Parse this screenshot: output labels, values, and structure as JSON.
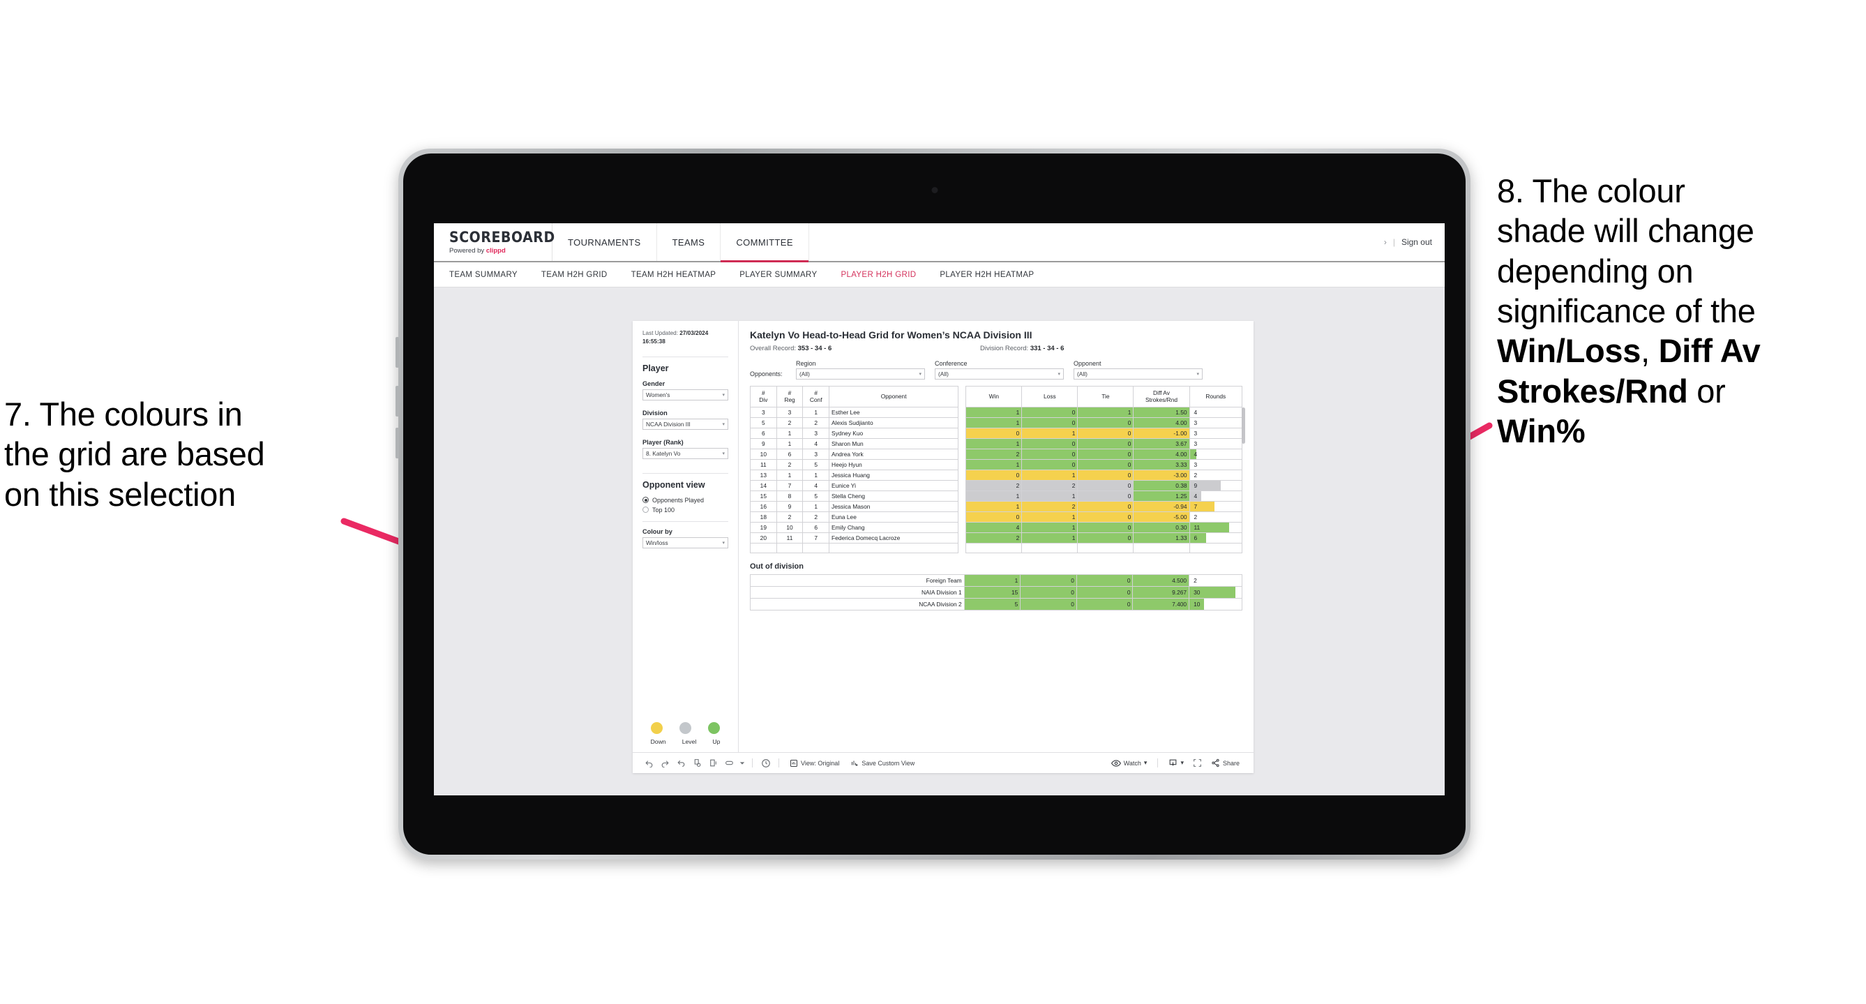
{
  "annotations": {
    "left": {
      "line1": "7. The colours in",
      "line2": "the grid are based",
      "line3": "on this selection"
    },
    "right": {
      "l1": "8. The colour",
      "l2": "shade will change",
      "l3": "depending on",
      "l4": "significance of the",
      "l5_bold_a": "Win/Loss",
      "l5_comma": ", ",
      "l5_bold_b": "Diff Av",
      "l6_bold": "Strokes/Rnd",
      "l6_or": " or",
      "l7_bold": "Win%"
    },
    "arrow_color": "#ea2a63"
  },
  "header": {
    "brand_name": "SCOREBOARD",
    "brand_sub_prefix": "Powered by ",
    "brand_sub_link": "clippd",
    "nav": [
      {
        "label": "TOURNAMENTS",
        "active": false
      },
      {
        "label": "TEAMS",
        "active": false
      },
      {
        "label": "COMMITTEE",
        "active": true
      }
    ],
    "chevron": "›",
    "separator": "|",
    "sign_out": "Sign out"
  },
  "subnav": [
    {
      "label": "TEAM SUMMARY",
      "active": false
    },
    {
      "label": "TEAM H2H GRID",
      "active": false
    },
    {
      "label": "TEAM H2H HEATMAP",
      "active": false
    },
    {
      "label": "PLAYER SUMMARY",
      "active": false
    },
    {
      "label": "PLAYER H2H GRID",
      "active": true
    },
    {
      "label": "PLAYER H2H HEATMAP",
      "active": false
    }
  ],
  "sidebar": {
    "last_updated_label": "Last Updated: ",
    "last_updated_value": "27/03/2024 16:55:38",
    "section_player": "Player",
    "gender_label": "Gender",
    "gender_value": "Women's",
    "division_label": "Division",
    "division_value": "NCAA Division III",
    "player_rank_label": "Player (Rank)",
    "player_rank_value": "8. Katelyn Vo",
    "opponent_view_label": "Opponent view",
    "opponent_view_options": [
      {
        "label": "Opponents Played",
        "selected": true
      },
      {
        "label": "Top 100",
        "selected": false
      }
    ],
    "colour_by_label": "Colour by",
    "colour_by_value": "Win/loss",
    "legend": [
      {
        "label": "Down",
        "color": "#f2d04b"
      },
      {
        "label": "Level",
        "color": "#c3c7cb"
      },
      {
        "label": "Up",
        "color": "#7dc462"
      }
    ]
  },
  "main": {
    "title": "Katelyn Vo Head-to-Head Grid for Women’s NCAA Division III",
    "overall_record_label": "Overall Record: ",
    "overall_record_value": "353 -  34 - 6",
    "division_record_label": "Division Record: ",
    "division_record_value": "331 -  34 - 6",
    "opponents_label": "Opponents:",
    "filters": [
      {
        "label": "Region",
        "value": "(All)"
      },
      {
        "label": "Conference",
        "value": "(All)"
      },
      {
        "label": "Opponent",
        "value": "(All)"
      }
    ]
  },
  "chart_data": {
    "type": "table",
    "title": "Katelyn Vo Head-to-Head Grid for Women’s NCAA Division III",
    "columns": [
      "# Div",
      "# Reg",
      "# Conf",
      "Opponent",
      "Win",
      "Loss",
      "Tie",
      "Diff Av Strokes/Rnd",
      "Rounds"
    ],
    "header_lines": {
      "div": [
        "#",
        "Div"
      ],
      "reg": [
        "#",
        "Reg"
      ],
      "conf": [
        "#",
        "Conf"
      ],
      "opponent": [
        "Opponent"
      ],
      "win": [
        "Win"
      ],
      "loss": [
        "Loss"
      ],
      "tie": [
        "Tie"
      ],
      "diff": [
        "Diff Av",
        "Strokes/Rnd"
      ],
      "rounds": [
        "Rounds"
      ]
    },
    "colour_scale": {
      "up": "#8ec96a",
      "level": "#cccccf",
      "down": "#f5d14e"
    },
    "rows": [
      {
        "div": "3",
        "reg": "3",
        "conf": "1",
        "opponent": "Esther Lee",
        "win": "1",
        "loss": "0",
        "tie": "1",
        "diff": "1.50",
        "rounds": "4",
        "state": "up",
        "bar_pct": 0
      },
      {
        "div": "5",
        "reg": "2",
        "conf": "2",
        "opponent": "Alexis Sudjianto",
        "win": "1",
        "loss": "0",
        "tie": "0",
        "diff": "4.00",
        "rounds": "3",
        "state": "up",
        "bar_pct": 0
      },
      {
        "div": "6",
        "reg": "1",
        "conf": "3",
        "opponent": "Sydney Kuo",
        "win": "0",
        "loss": "1",
        "tie": "0",
        "diff": "-1.00",
        "rounds": "3",
        "state": "down",
        "bar_pct": 0
      },
      {
        "div": "9",
        "reg": "1",
        "conf": "4",
        "opponent": "Sharon Mun",
        "win": "1",
        "loss": "0",
        "tie": "0",
        "diff": "3.67",
        "rounds": "3",
        "state": "up",
        "bar_pct": 0
      },
      {
        "div": "10",
        "reg": "6",
        "conf": "3",
        "opponent": "Andrea York",
        "win": "2",
        "loss": "0",
        "tie": "0",
        "diff": "4.00",
        "rounds": "4",
        "state": "up",
        "bar_pct": 13
      },
      {
        "div": "11",
        "reg": "2",
        "conf": "5",
        "opponent": "Heejo Hyun",
        "win": "1",
        "loss": "0",
        "tie": "0",
        "diff": "3.33",
        "rounds": "3",
        "state": "up",
        "bar_pct": 0
      },
      {
        "div": "13",
        "reg": "1",
        "conf": "1",
        "opponent": "Jessica Huang",
        "win": "0",
        "loss": "1",
        "tie": "0",
        "diff": "-3.00",
        "rounds": "2",
        "state": "down",
        "bar_pct": 0
      },
      {
        "div": "14",
        "reg": "7",
        "conf": "4",
        "opponent": "Eunice Yi",
        "win": "2",
        "loss": "2",
        "tie": "0",
        "diff": "0.38",
        "rounds": "9",
        "state": "level",
        "bar_pct": 60
      },
      {
        "div": "15",
        "reg": "8",
        "conf": "5",
        "opponent": "Stella Cheng",
        "win": "1",
        "loss": "1",
        "tie": "0",
        "diff": "1.25",
        "rounds": "4",
        "state": "level",
        "bar_pct": 22
      },
      {
        "div": "16",
        "reg": "9",
        "conf": "1",
        "opponent": "Jessica Mason",
        "win": "1",
        "loss": "2",
        "tie": "0",
        "diff": "-0.94",
        "rounds": "7",
        "state": "down",
        "bar_pct": 48
      },
      {
        "div": "18",
        "reg": "2",
        "conf": "2",
        "opponent": "Euna Lee",
        "win": "0",
        "loss": "1",
        "tie": "0",
        "diff": "-5.00",
        "rounds": "2",
        "state": "down",
        "bar_pct": 0
      },
      {
        "div": "19",
        "reg": "10",
        "conf": "6",
        "opponent": "Emily Chang",
        "win": "4",
        "loss": "1",
        "tie": "0",
        "diff": "0.30",
        "rounds": "11",
        "state": "up",
        "bar_pct": 76
      },
      {
        "div": "20",
        "reg": "11",
        "conf": "7",
        "opponent": "Federica Domecq Lacroze",
        "win": "2",
        "loss": "1",
        "tie": "0",
        "diff": "1.33",
        "rounds": "6",
        "state": "up",
        "bar_pct": 32
      }
    ],
    "out_of_division": {
      "title": "Out of division",
      "rows": [
        {
          "name": "Foreign Team",
          "win": "1",
          "loss": "0",
          "tie": "0",
          "diff": "4.500",
          "rounds": "2",
          "state": "up",
          "bar_pct": 0
        },
        {
          "name": "NAIA Division 1",
          "win": "15",
          "loss": "0",
          "tie": "0",
          "diff": "9.267",
          "rounds": "30",
          "state": "up",
          "bar_pct": 88
        },
        {
          "name": "NCAA Division 2",
          "win": "5",
          "loss": "0",
          "tie": "0",
          "diff": "7.400",
          "rounds": "10",
          "state": "up",
          "bar_pct": 28
        }
      ]
    }
  },
  "toolbar": {
    "icons": [
      "undo-icon",
      "redo-icon",
      "revert-icon",
      "refresh-icon",
      "pause-icon",
      "highlight-icon"
    ],
    "view_label": "View: Original",
    "save_custom_view_label": "Save Custom View",
    "watch_label": "Watch",
    "share_label": "Share",
    "caret": "▾"
  }
}
